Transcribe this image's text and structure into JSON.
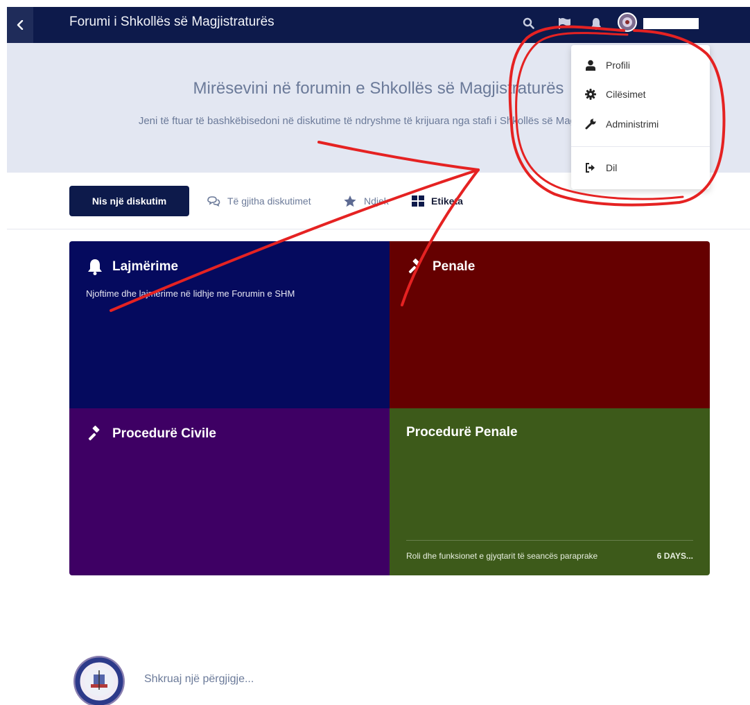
{
  "header": {
    "title": "Forumi i Shkollës së Magjistraturës"
  },
  "hero": {
    "title": "Mirësevini në forumin e Shkollës së Magjistraturës",
    "description": "Jeni të ftuar të bashkëbisedoni në diskutime të ndryshme të krijuara nga stafi i Shkollës së Magjistraturës."
  },
  "toolbar": {
    "start_label": "Nis një diskutim",
    "all_discussions": "Të gjitha diskutimet",
    "following": "Ndjek",
    "tags": "Etiketa"
  },
  "tiles": [
    {
      "name": "Lajmërime",
      "description": "Njoftime dhe lajmërime në lidhje me Forumin e SHM",
      "color": "#050a5e",
      "icon": "bell-icon"
    },
    {
      "name": "Penale",
      "description": "",
      "color": "#650000",
      "icon": "gavel-icon"
    },
    {
      "name": "Procedurë Civile",
      "description": "",
      "color": "#3e0064",
      "icon": "gavel-icon"
    },
    {
      "name": "Procedurë Penale",
      "description": "",
      "color": "#3d5a1a",
      "icon": "",
      "last_discussion": "Roli dhe funksionet e gjyqtarit të seancës paraprake",
      "last_time": "6 DAYS..."
    }
  ],
  "user_menu": {
    "items": [
      {
        "label": "Profili",
        "icon": "user-icon"
      },
      {
        "label": "Cilësimet",
        "icon": "gear-icon"
      },
      {
        "label": "Administrimi",
        "icon": "wrench-icon"
      },
      {
        "label": "Dil",
        "icon": "sign-out-icon"
      }
    ]
  },
  "reply": {
    "placeholder": "Shkruaj një përgjigje..."
  },
  "colors": {
    "header_bg": "#0d1a4b",
    "hero_bg": "#e3e7f2",
    "annotation": "#e52222"
  }
}
